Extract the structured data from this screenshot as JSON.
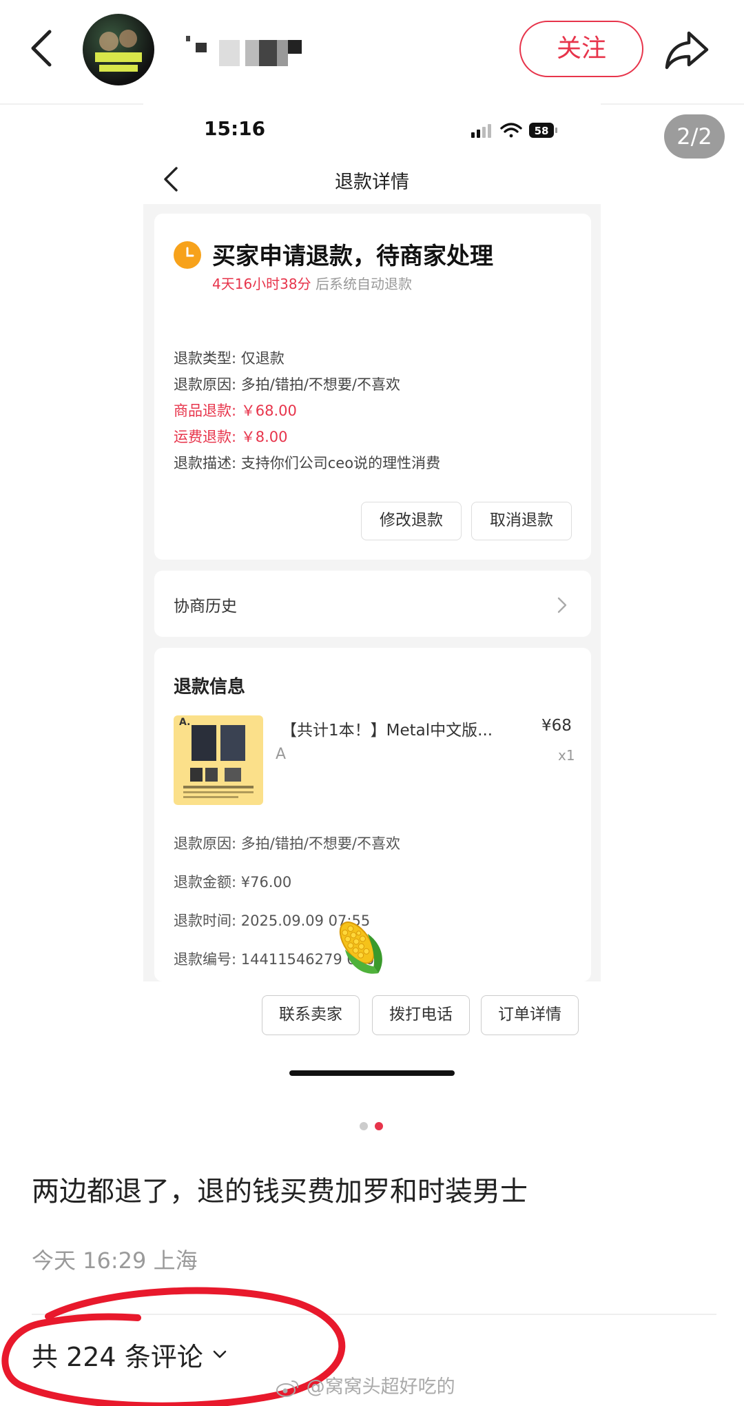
{
  "header": {
    "follow_label": "关注"
  },
  "image_counter": "2/2",
  "shot": {
    "status_time": "15:16",
    "battery": "58",
    "title": "退款详情",
    "status": {
      "heading": "买家申请退款，待商家处理",
      "countdown": "4天16小时38分",
      "countdown_suffix": "后系统自动退款"
    },
    "details": [
      "退款类型: 仅退款",
      "退款原因: 多拍/错拍/不想要/不喜欢",
      "商品退款: ￥68.00",
      "运费退款: ￥8.00",
      "退款描述: 支持你们公司ceo说的理性消费"
    ],
    "buttons": {
      "modify": "修改退款",
      "cancel": "取消退款"
    },
    "history_label": "协商历史",
    "refund_info": {
      "title": "退款信息",
      "product_name": "【共计1本！】Metal中文版...",
      "product_price": "¥68",
      "product_spec": "A",
      "product_qty": "x1",
      "thumb_label": "A.",
      "rows": [
        "退款原因:  多拍/错拍/不想要/不喜欢",
        "退款金额:  ¥76.00",
        "退款时间:  2025.09.09 07:55",
        "退款编号:  14411546279 080"
      ]
    },
    "bottom_buttons": [
      "联系卖家",
      "拨打电话",
      "订单详情"
    ]
  },
  "post": {
    "body": "两边都退了，退的钱买费加罗和时装男士",
    "meta": "今天 16:29 上海",
    "comments": "共 224 条评论",
    "watermark": "@窝窝头超好吃的"
  },
  "colors": {
    "accent": "#e7344b",
    "clock": "#f7a21b",
    "circle_annotation": "#e8192c"
  }
}
